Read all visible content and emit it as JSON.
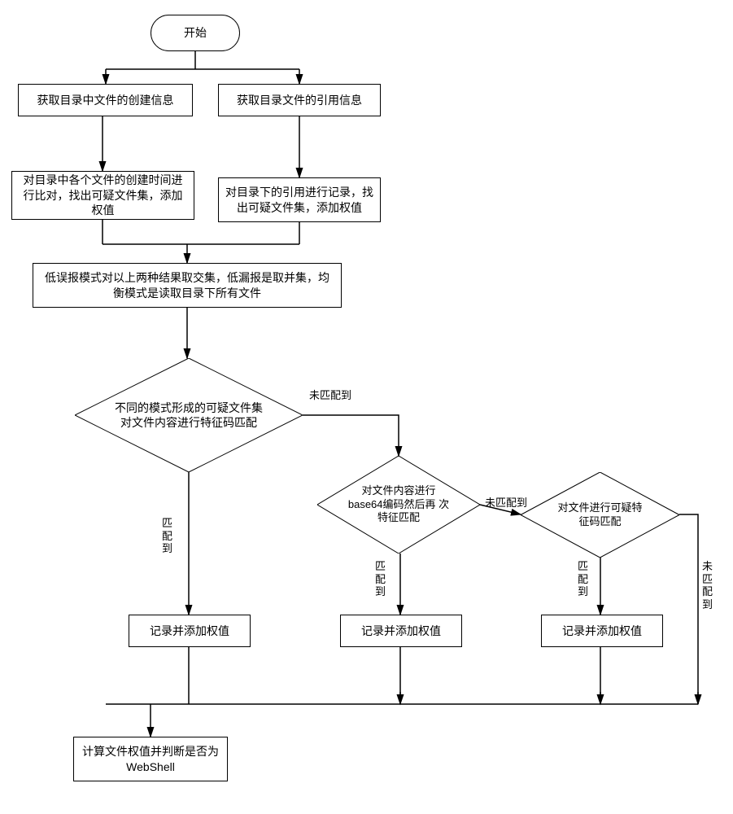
{
  "nodes": {
    "start": "开始",
    "get_create": "获取目录中文件的创建信息",
    "get_ref": "获取目录文件的引用信息",
    "cmp_create": "对目录中各个文件的创建时间进行比对，找出可疑文件集，添加权值",
    "cmp_ref": "对目录下的引用进行记录，找出可疑文件集，添加权值",
    "modes": "低误报模式对以上两种结果取交集，低漏报是取并集，均衡模式是读取目录下所有文件",
    "d1": "不同的模式形成的可疑文件集\n对文件内容进行特征码匹配",
    "d2": "对文件内容进行\nbase64编码然后再\n次特征匹配",
    "d3": "对文件进行可疑特\n征码匹配",
    "rec1": "记录并添加权值",
    "rec2": "记录并添加权值",
    "rec3": "记录并添加权值",
    "final": "计算文件权值并判断是否为WebShell"
  },
  "edges": {
    "match": "匹\n配\n到",
    "nomatch_inline": "未匹配到",
    "nomatch_vert": "未\n匹\n配\n到"
  }
}
